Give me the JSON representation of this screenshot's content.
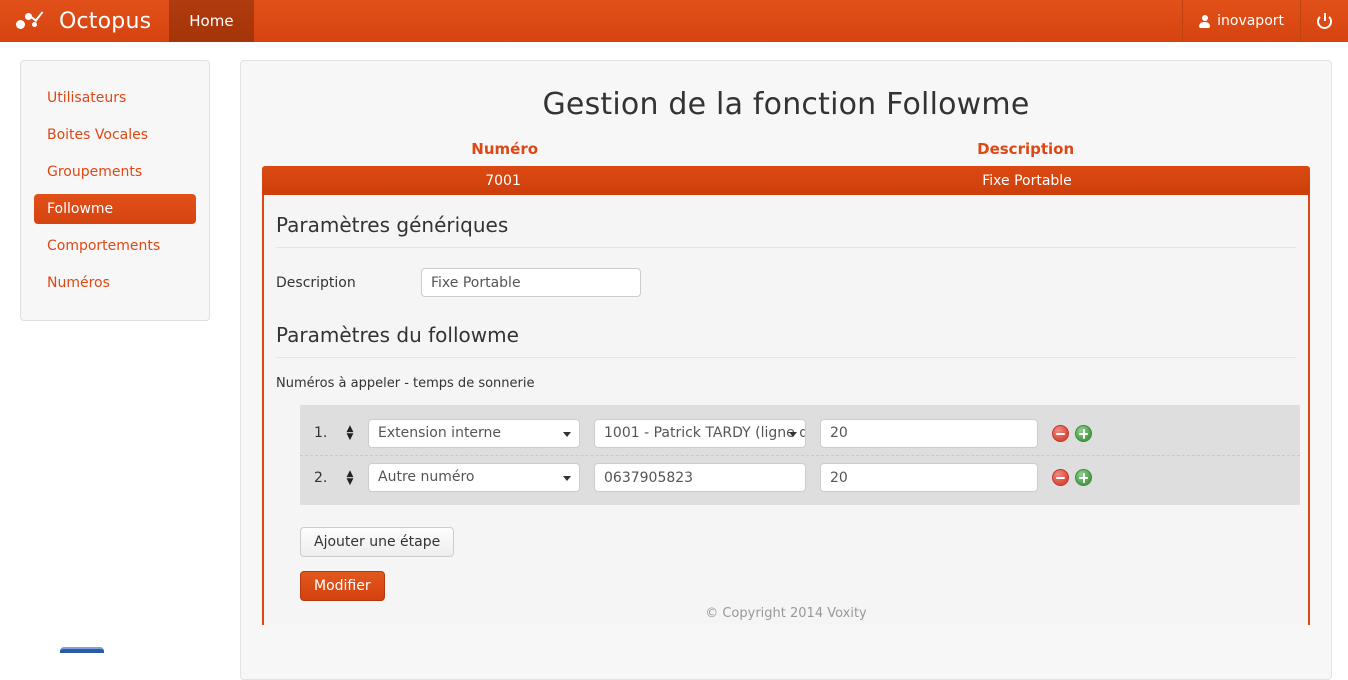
{
  "navbar": {
    "brand": "Octopus",
    "logo_icon": "octopus-dots-logo",
    "home_tab": "Home",
    "user_name": "inovaport",
    "user_icon": "user-icon",
    "power_icon": "power-icon"
  },
  "sidebar": {
    "items": [
      {
        "label": "Utilisateurs",
        "active": false
      },
      {
        "label": "Boites Vocales",
        "active": false
      },
      {
        "label": "Groupements",
        "active": false
      },
      {
        "label": "Followme",
        "active": true
      },
      {
        "label": "Comportements",
        "active": false
      },
      {
        "label": "Numéros",
        "active": false
      }
    ]
  },
  "main": {
    "page_title": "Gestion de la fonction Followme",
    "table": {
      "headers": {
        "numero": "Numéro",
        "description": "Description"
      },
      "selected_row": {
        "numero": "7001",
        "description": "Fixe Portable"
      }
    },
    "generic_section": {
      "title": "Paramètres génériques",
      "description_label": "Description",
      "description_value": "Fixe Portable",
      "description_placeholder": "Description"
    },
    "followme_section": {
      "title": "Paramètres du followme",
      "sub_label": "Numéros à appeler - temps de sonnerie",
      "steps": [
        {
          "index": "1.",
          "drag_icon": "drag-handle-icon",
          "type": "Extension interne",
          "target_kind": "select",
          "target": "1001 - Patrick TARDY (ligne d",
          "ring_time": "20",
          "remove_icon": "minus-circle-icon",
          "add_icon": "plus-circle-icon"
        },
        {
          "index": "2.",
          "drag_icon": "drag-handle-icon",
          "type": "Autre numéro",
          "target_kind": "input",
          "target": "0637905823",
          "ring_time": "20",
          "remove_icon": "minus-circle-icon",
          "add_icon": "plus-circle-icon"
        }
      ],
      "add_step_button": "Ajouter une étape",
      "submit_button": "Modifier"
    }
  },
  "footer": {
    "copyright": "© Copyright 2014 Voxity"
  },
  "colors": {
    "brand_orange": "#dd4814",
    "orange_dark": "#a43409",
    "panel_bg": "#f5f5f5",
    "row_bg": "#dedede",
    "remove_red": "#db4a3b",
    "add_green": "#4a9d4a"
  }
}
